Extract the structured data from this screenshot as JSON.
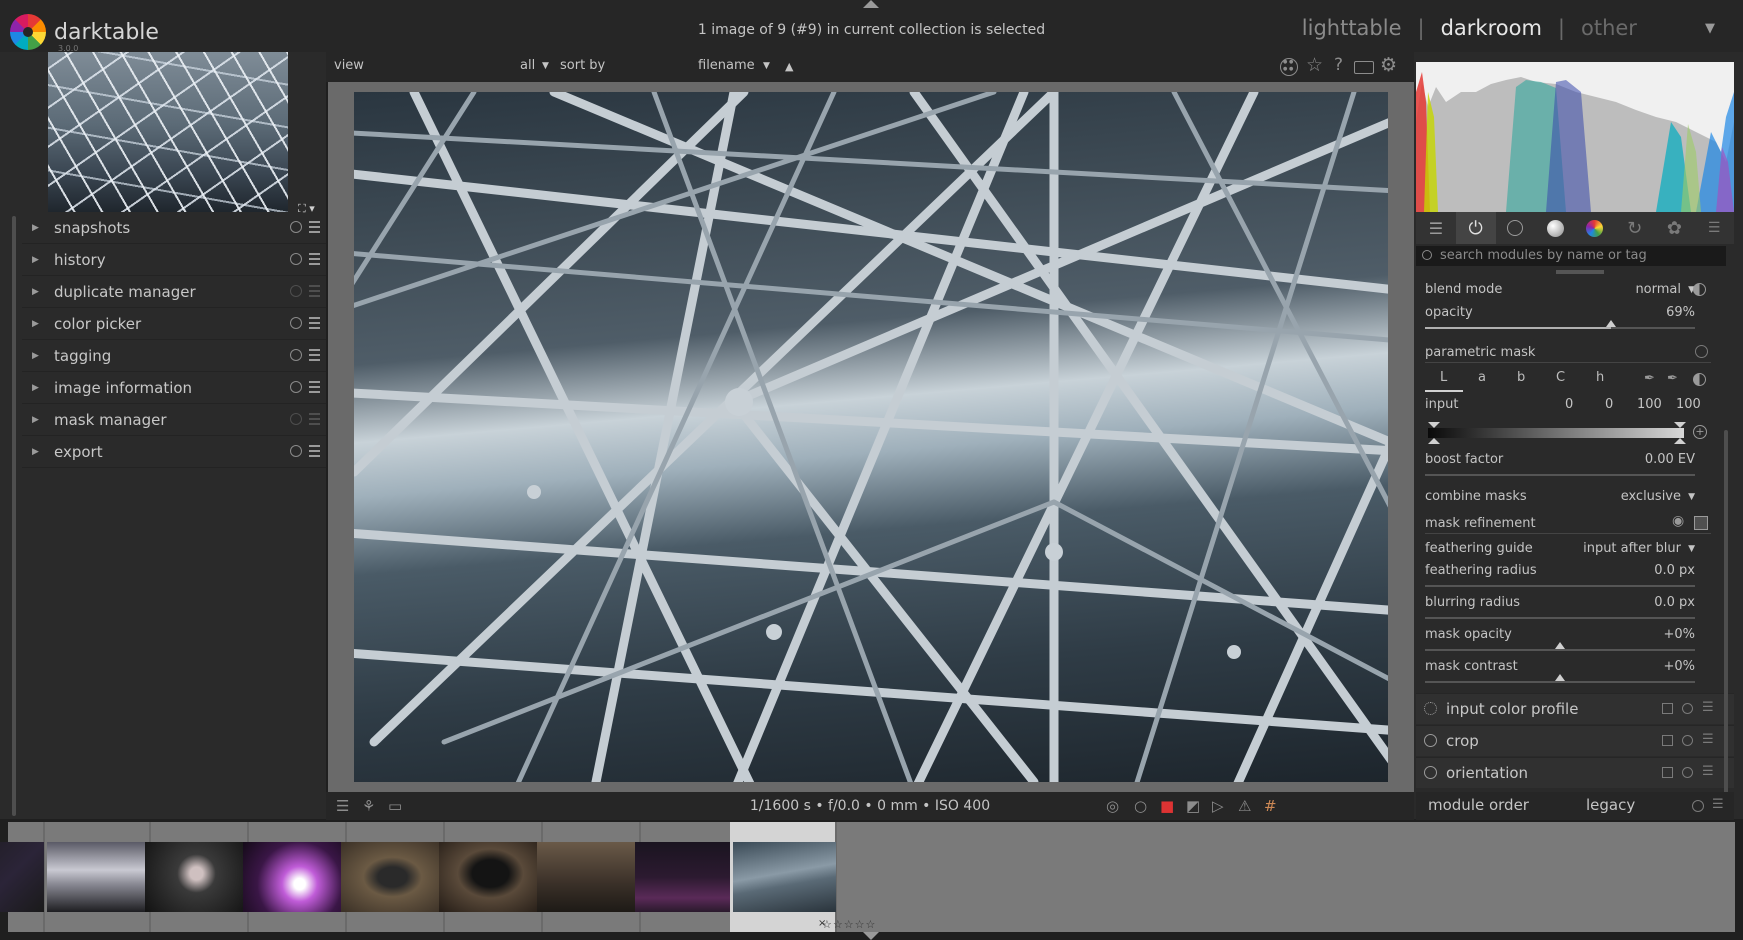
{
  "app": {
    "name": "darktable",
    "version": "3.0.0"
  },
  "header": {
    "collection_info": "1 image of 9 (#9) in current collection is selected",
    "views": {
      "lighttable": "lighttable",
      "separator": "|",
      "darkroom": "darkroom",
      "other": "other"
    }
  },
  "toolbar": {
    "view_label": "view",
    "filter_value": "all",
    "sort_label": "sort by",
    "sort_value": "filename",
    "sort_direction_icon": "triangle-up"
  },
  "left_panel": {
    "modules": [
      {
        "label": "snapshots",
        "reset_active": true
      },
      {
        "label": "history",
        "reset_active": true
      },
      {
        "label": "duplicate manager",
        "reset_active": false
      },
      {
        "label": "color picker",
        "reset_active": true
      },
      {
        "label": "tagging",
        "reset_active": true
      },
      {
        "label": "image information",
        "reset_active": true
      },
      {
        "label": "mask manager",
        "reset_active": false
      },
      {
        "label": "export",
        "reset_active": true
      }
    ]
  },
  "image_info": {
    "exif": "1/1600 s • f/0.0 • 0 mm • ISO 400"
  },
  "right_panel": {
    "search_placeholder": "search modules by name or tag",
    "blend": {
      "blend_mode_label": "blend mode",
      "blend_mode_value": "normal",
      "opacity_label": "opacity",
      "opacity_value": "69%",
      "opacity_fraction": 0.69,
      "parametric_mask_label": "parametric mask",
      "channels": [
        "L",
        "a",
        "b",
        "C",
        "h"
      ],
      "input_label": "input",
      "input_values": [
        "0",
        "0",
        "100",
        "100"
      ],
      "boost_factor_label": "boost factor",
      "boost_factor_value": "0.00 EV",
      "combine_masks_label": "combine masks",
      "combine_masks_value": "exclusive",
      "mask_refinement_label": "mask refinement",
      "feathering_guide_label": "feathering guide",
      "feathering_guide_value": "input after blur",
      "feathering_radius_label": "feathering radius",
      "feathering_radius_value": "0.0 px",
      "blurring_radius_label": "blurring radius",
      "blurring_radius_value": "0.0 px",
      "mask_opacity_label": "mask opacity",
      "mask_opacity_value": "+0%",
      "mask_contrast_label": "mask contrast",
      "mask_contrast_value": "+0%"
    },
    "modules": [
      {
        "label": "input color profile"
      },
      {
        "label": "crop"
      },
      {
        "label": "orientation"
      }
    ],
    "module_order_label": "module order",
    "module_order_value": "legacy"
  },
  "filmstrip": {
    "count": 9,
    "selected_index": 8,
    "selected_stars": "☆☆☆☆☆",
    "reject_mark": "×"
  },
  "colors": {
    "background": "#1f1f1f",
    "panel": "#2a2a2a",
    "filmstrip": "#7a7a7a",
    "text": "#c4c4c4"
  }
}
